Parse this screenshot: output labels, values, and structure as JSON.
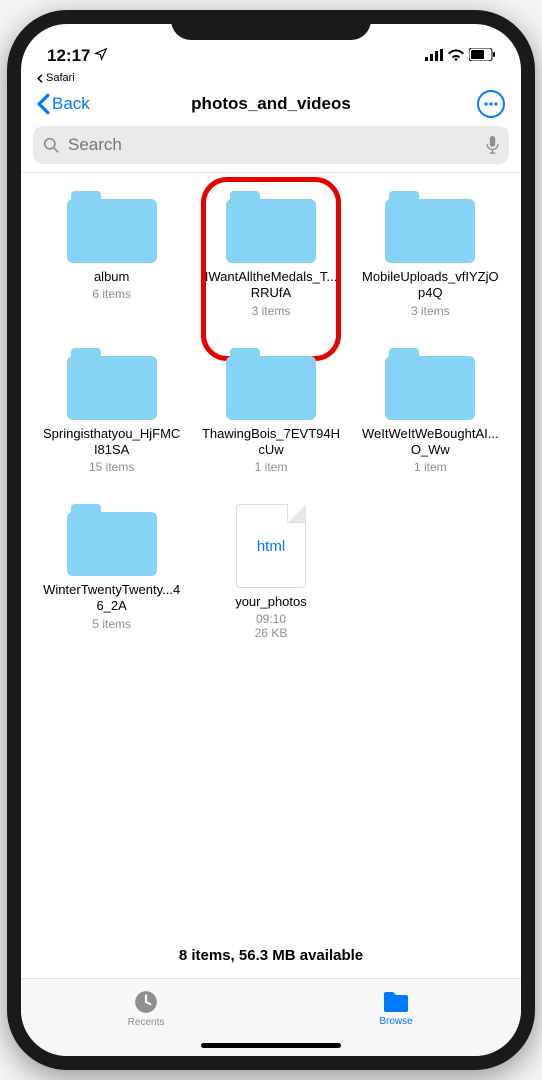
{
  "status": {
    "time": "12:17",
    "breadcrumb_app": "Safari"
  },
  "nav": {
    "back_label": "Back",
    "title": "photos_and_videos"
  },
  "search": {
    "placeholder": "Search"
  },
  "items": [
    {
      "type": "folder",
      "name": "album",
      "sub": "6 items",
      "highlighted": false
    },
    {
      "type": "folder",
      "name": "IWantAlltheMedals_T...RRUfA",
      "sub": "3 items",
      "highlighted": true
    },
    {
      "type": "folder",
      "name": "MobileUploads_vfIYZjOp4Q",
      "sub": "3 items",
      "highlighted": false
    },
    {
      "type": "folder",
      "name": "Springisthatyou_HjFMCI81SA",
      "sub": "15 items",
      "highlighted": false
    },
    {
      "type": "folder",
      "name": "ThawingBois_7EVT94HcUw",
      "sub": "1 item",
      "highlighted": false
    },
    {
      "type": "folder",
      "name": "WeItWeItWeBoughtAI...O_Ww",
      "sub": "1 item",
      "highlighted": false
    },
    {
      "type": "folder",
      "name": "WinterTwentyTwenty...46_2A",
      "sub": "5 items",
      "highlighted": false
    },
    {
      "type": "file",
      "name": "your_photos",
      "sub": "09:10\n26 KB",
      "badge": "html",
      "highlighted": false
    }
  ],
  "summary": "8 items, 56.3 MB available",
  "tabs": {
    "recents": "Recents",
    "browse": "Browse"
  }
}
